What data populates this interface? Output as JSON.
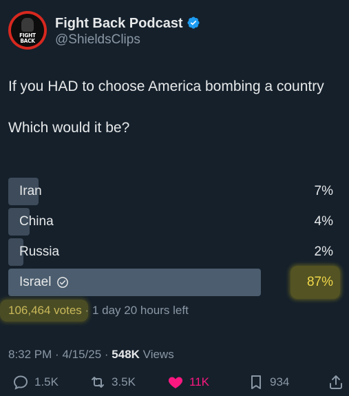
{
  "author": {
    "display_name": "Fight Back Podcast",
    "handle": "@ShieldsClips",
    "avatar_text": "FIGHT BACK",
    "verified_color": "#1d9bf0"
  },
  "post": {
    "line1": "If you HAD to choose America bombing a country",
    "line2": "Which would it be?"
  },
  "poll": {
    "options": [
      {
        "label": "Iran",
        "percent_text": "7%",
        "percent": 7,
        "winner": false
      },
      {
        "label": "China",
        "percent_text": "4%",
        "percent": 4,
        "winner": false
      },
      {
        "label": "Russia",
        "percent_text": "2%",
        "percent": 2,
        "winner": false
      },
      {
        "label": "Israel",
        "percent_text": "87%",
        "percent": 87,
        "winner": true
      }
    ],
    "votes": "106,464 votes",
    "time_left": "1 day 20 hours left"
  },
  "meta": {
    "time": "8:32 PM",
    "date": "4/15/25",
    "views_count": "548K",
    "views_label": "Views"
  },
  "actions": {
    "replies": "1.5K",
    "reposts": "3.5K",
    "likes": "11K",
    "bookmarks": "934"
  },
  "colors": {
    "background": "#15202b",
    "like": "#f91880",
    "highlight": "#c8b414"
  }
}
